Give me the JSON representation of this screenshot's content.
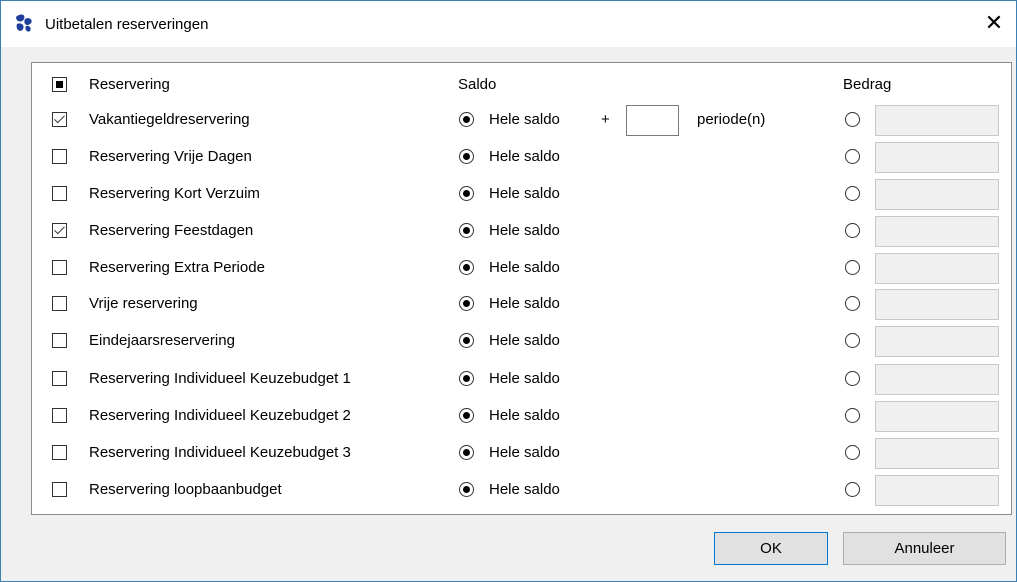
{
  "window": {
    "title": "Uitbetalen reserveringen",
    "close_glyph": "✕"
  },
  "columns": {
    "reservering": "Reservering",
    "saldo": "Saldo",
    "bedrag": "Bedrag"
  },
  "rows": [
    {
      "label": "Vakantiegeldreservering",
      "checked": true,
      "saldo_label": "Hele saldo",
      "extra_periods": true,
      "plus": "+",
      "periods_label": "periode(n)",
      "periods_value": ""
    },
    {
      "label": "Reservering Vrije Dagen",
      "checked": false,
      "saldo_label": "Hele saldo"
    },
    {
      "label": "Reservering Kort Verzuim",
      "checked": false,
      "saldo_label": "Hele saldo"
    },
    {
      "label": "Reservering Feestdagen",
      "checked": true,
      "saldo_label": "Hele saldo"
    },
    {
      "label": "Reservering Extra Periode",
      "checked": false,
      "saldo_label": "Hele saldo"
    },
    {
      "label": "Vrije reservering",
      "checked": false,
      "saldo_label": "Hele saldo"
    },
    {
      "label": "Eindejaarsreservering",
      "checked": false,
      "saldo_label": "Hele saldo"
    },
    {
      "label": "Reservering Individueel Keuzebudget 1",
      "checked": false,
      "saldo_label": "Hele saldo"
    },
    {
      "label": "Reservering Individueel Keuzebudget 2",
      "checked": false,
      "saldo_label": "Hele saldo"
    },
    {
      "label": "Reservering Individueel Keuzebudget 3",
      "checked": false,
      "saldo_label": "Hele saldo"
    },
    {
      "label": "Reservering loopbaanbudget",
      "checked": false,
      "saldo_label": "Hele saldo"
    }
  ],
  "buttons": {
    "ok": "OK",
    "cancel": "Annuleer"
  },
  "colors": {
    "accent": "#3c7fb1",
    "panel_border": "#8c8c8c",
    "dialog_bg": "#f0f0f0",
    "icon": "#1f3f9a"
  },
  "icons": {
    "app": "app-logo-icon",
    "close": "close-icon"
  }
}
